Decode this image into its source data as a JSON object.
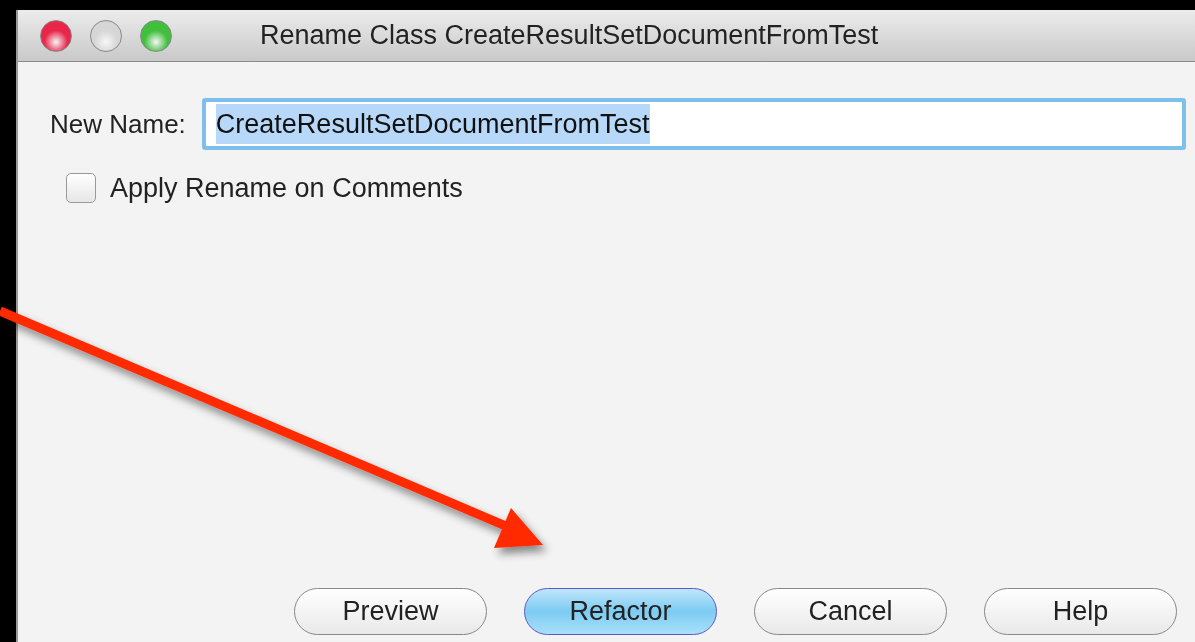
{
  "window": {
    "title": "Rename Class CreateResultSetDocumentFromTest"
  },
  "new_name": {
    "label": "New Name:",
    "value": "CreateResultSetDocumentFromTest",
    "value_selected": true
  },
  "apply_on_comments": {
    "label": "Apply Rename on Comments",
    "checked": false
  },
  "buttons": [
    {
      "label": "Preview",
      "default": false
    },
    {
      "label": "Refactor",
      "default": true
    },
    {
      "label": "Cancel",
      "default": false
    },
    {
      "label": "Help",
      "default": false
    }
  ]
}
